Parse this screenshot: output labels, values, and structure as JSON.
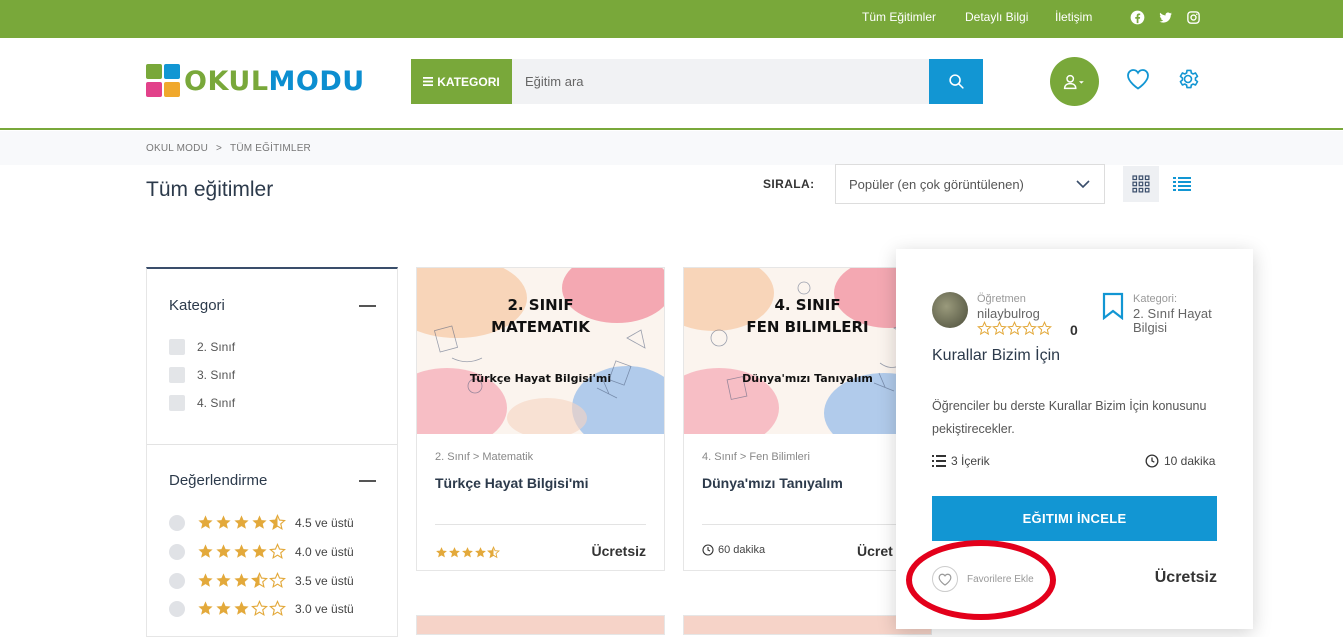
{
  "topbar": {
    "links": [
      "Tüm Eğitimler",
      "Detaylı Bilgi",
      "İletişim"
    ],
    "social_icons": [
      "facebook-icon",
      "twitter-icon",
      "instagram-icon"
    ]
  },
  "header": {
    "logo_part1": "OKUL",
    "logo_part2": "MODU",
    "category_button": "KATEGORI",
    "search_placeholder": "Eğitim ara",
    "icons": [
      "search-icon",
      "user-icon",
      "heart-icon",
      "gear-icon"
    ]
  },
  "breadcrumb": [
    "OKUL MODU",
    "TÜM EĞİTIMLER"
  ],
  "page": {
    "title": "Tüm eğitimler",
    "sort_label": "SIRALA:",
    "sort_value": "Popüler (en çok görüntülenen)"
  },
  "sidebar": {
    "category_title": "Kategori",
    "categories": [
      "2. Sınıf",
      "3. Sınıf",
      "4. Sınıf"
    ],
    "rating_title": "Değerlendirme",
    "ratings": [
      {
        "label": "4.5 ve üstü",
        "stars": 4.5
      },
      {
        "label": "4.0 ve üstü",
        "stars": 4.0
      },
      {
        "label": "3.5 ve üstü",
        "stars": 3.5
      },
      {
        "label": "3.0 ve üstü",
        "stars": 3.0
      }
    ]
  },
  "cards": [
    {
      "thumb_title_line1": "2. SINIF",
      "thumb_title_line2": "MATEMATIK",
      "thumb_subtitle": "Türkçe Hayat Bilgisi'mi",
      "category": "2. Sınıf > Matematik",
      "title": "Türkçe Hayat Bilgisi'mi",
      "stars": 4.5,
      "price": "Ücretsiz"
    },
    {
      "thumb_title_line1": "4. SINIF",
      "thumb_title_line2": "FEN BILIMLERI",
      "thumb_subtitle": "Dünya'mızı Tanıyalım",
      "category": "4. Sınıf > Fen Bilimleri",
      "title": "Dünya'mızı Tanıyalım",
      "duration": "60 dakika",
      "price": "Ücret"
    }
  ],
  "popover": {
    "teacher_label": "Öğretmen",
    "teacher_name": "nilaybulrog",
    "rating_count": "0",
    "category_label": "Kategori:",
    "category_value": "2. Sınıf Hayat Bilgisi",
    "title": "Kurallar Bizim İçin",
    "description": "Öğrenciler bu derste Kurallar Bizim İçin konusunu pekiştirecekler.",
    "content_count": "3 İçerik",
    "duration": "10 dakika",
    "cta": "EĞITIMI İNCELE",
    "favorite_label": "Favorilere Ekle",
    "price": "Ücretsiz"
  },
  "colors": {
    "brand_green": "#79a83a",
    "brand_blue": "#1296d3",
    "star_gold": "#e3a93b",
    "highlight_red": "#e3001b"
  }
}
